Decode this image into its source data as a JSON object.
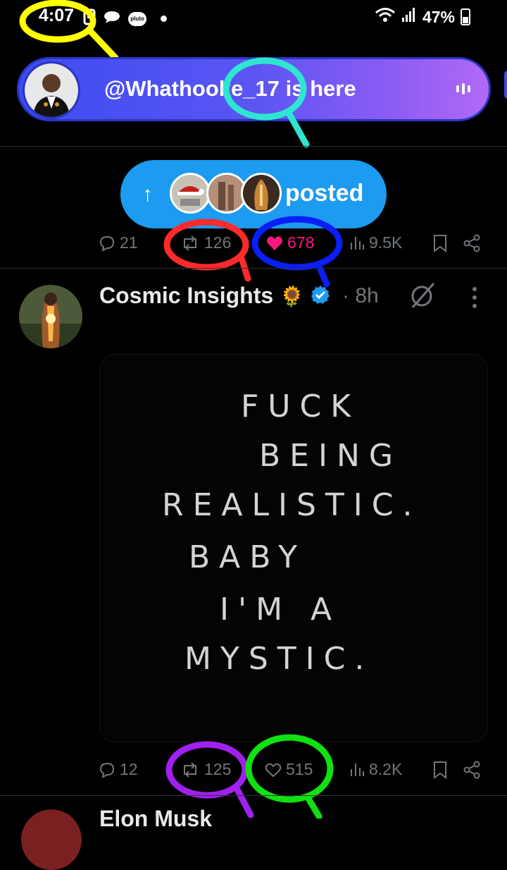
{
  "status_bar": {
    "time": "4:07",
    "battery": "47%",
    "left_icons": [
      "notification-icon",
      "chat-icon",
      "pluto-tv-icon",
      "dot-icon"
    ],
    "pluto_label": "pluto tv",
    "right_icons": [
      "wifi-icon",
      "signal-icon",
      "battery-icon"
    ]
  },
  "live_banner": {
    "text": "@Whathooke_17 is here",
    "color_start": "#3d4cf2",
    "color_end": "#b169f5"
  },
  "posted_pill": {
    "label": "posted",
    "arrow": "↑",
    "color": "#1d9bf0"
  },
  "top_actions": {
    "replies": "21",
    "reposts": "126",
    "likes": "678",
    "views": "9.5K",
    "liked": true,
    "like_color": "#f91880"
  },
  "tweet": {
    "author": "Cosmic Insights",
    "emoji": "🌻",
    "time": "8h",
    "separator": "·",
    "verified_color": "#1d9bf0",
    "image_text": [
      "FUCK",
      "BEING",
      "REALISTIC.",
      "BABY",
      "I'M A",
      "MYSTIC."
    ],
    "actions": {
      "replies": "12",
      "reposts": "125",
      "likes": "515",
      "views": "8.2K"
    }
  },
  "next_tweet": {
    "author": "Elon Musk"
  },
  "annotations": {
    "colors": [
      "#ffff00",
      "#2ee6d0",
      "#ff2a2a",
      "#0a1ef5",
      "#a020f0",
      "#10e010"
    ]
  }
}
